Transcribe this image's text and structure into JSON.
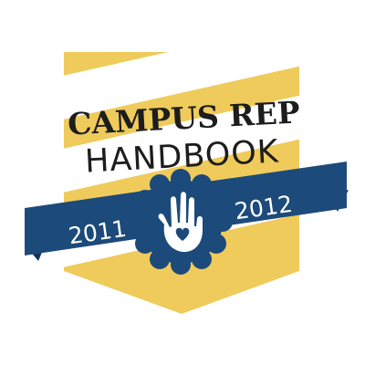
{
  "badge": {
    "title_line1": "CAMPUS REP",
    "title_line2": "HANDBOOK",
    "year_start": "2011",
    "year_end": "2012",
    "emblem_icon": "handprint-heart-icon"
  },
  "colors": {
    "background": "#ffffff",
    "banner_gold": "#efcb5b",
    "stripe_white": "#ffffff",
    "ribbon_navy": "#1c4a7a",
    "ribbon_dark": "#123456",
    "emblem_navy": "#1c4a7a",
    "text_dark": "#1d1d1d",
    "year_text": "#ffffff"
  }
}
